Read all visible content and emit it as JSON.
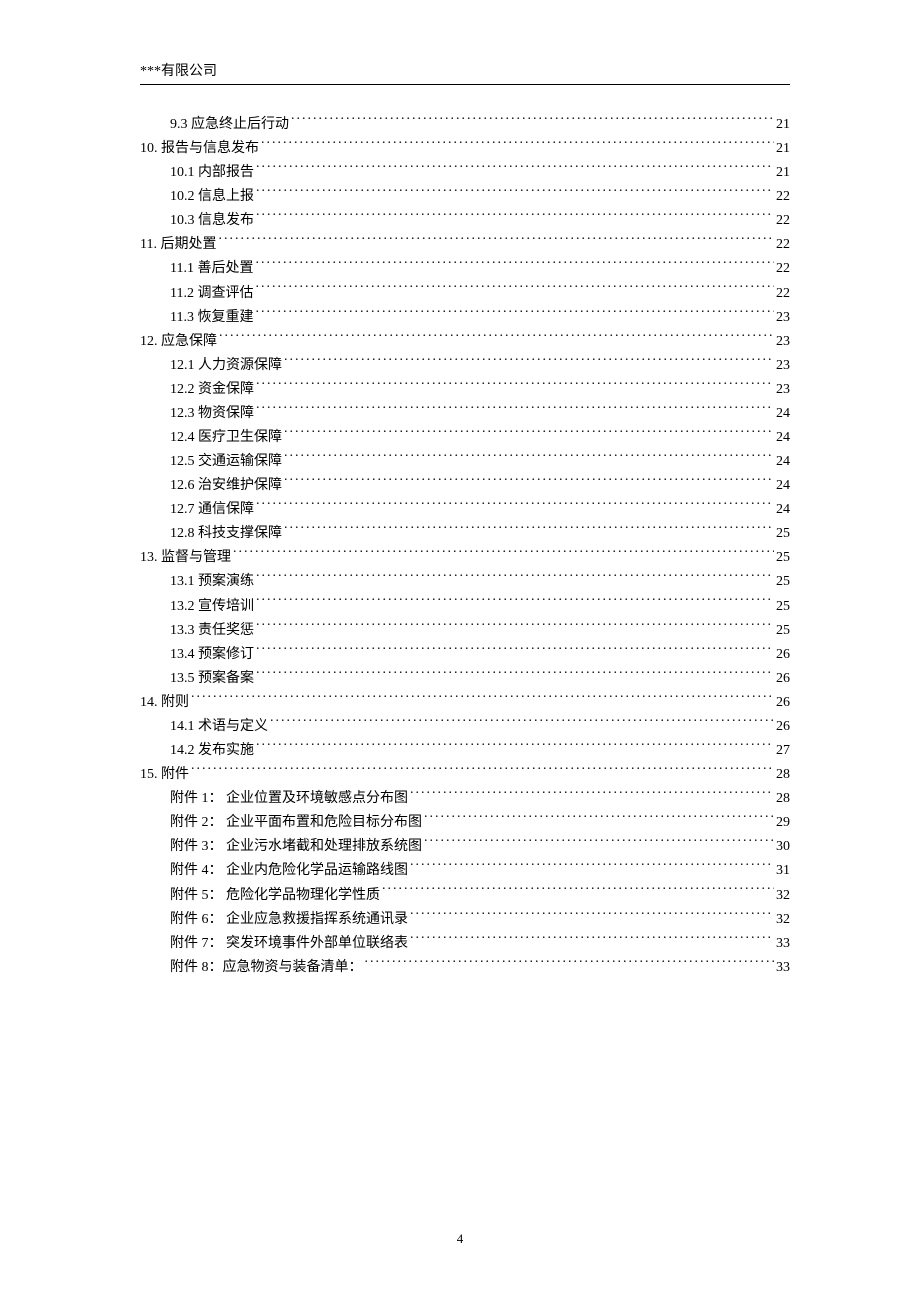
{
  "header": "***有限公司",
  "pageNumber": "4",
  "toc": [
    {
      "level": 2,
      "label": "9.3  应急终止后行动",
      "page": "21"
    },
    {
      "level": 1,
      "label": "10.  报告与信息发布",
      "page": "21"
    },
    {
      "level": 2,
      "label": "10.1  内部报告",
      "page": "21"
    },
    {
      "level": 2,
      "label": "10.2  信息上报",
      "page": "22"
    },
    {
      "level": 2,
      "label": "10.3  信息发布",
      "page": "22"
    },
    {
      "level": 1,
      "label": "11.  后期处置",
      "page": "22"
    },
    {
      "level": 2,
      "label": "11.1  善后处置",
      "page": "22"
    },
    {
      "level": 2,
      "label": "11.2  调查评估",
      "page": "22"
    },
    {
      "level": 2,
      "label": "11.3  恢复重建",
      "page": "23"
    },
    {
      "level": 1,
      "label": "12.  应急保障",
      "page": "23"
    },
    {
      "level": 2,
      "label": "12.1  人力资源保障",
      "page": "23"
    },
    {
      "level": 2,
      "label": "12.2  资金保障",
      "page": "23"
    },
    {
      "level": 2,
      "label": "12.3  物资保障",
      "page": "24"
    },
    {
      "level": 2,
      "label": "12.4  医疗卫生保障",
      "page": "24"
    },
    {
      "level": 2,
      "label": "12.5  交通运输保障",
      "page": "24"
    },
    {
      "level": 2,
      "label": "12.6  治安维护保障",
      "page": "24"
    },
    {
      "level": 2,
      "label": "12.7  通信保障",
      "page": "24"
    },
    {
      "level": 2,
      "label": "12.8  科技支撑保障",
      "page": "25"
    },
    {
      "level": 1,
      "label": "13.  监督与管理",
      "page": "25"
    },
    {
      "level": 2,
      "label": "13.1  预案演练",
      "page": "25"
    },
    {
      "level": 2,
      "label": "13.2  宣传培训",
      "page": "25"
    },
    {
      "level": 2,
      "label": "13.3  责任奖惩",
      "page": "25"
    },
    {
      "level": 2,
      "label": "13.4  预案修订",
      "page": "26"
    },
    {
      "level": 2,
      "label": "13.5  预案备案",
      "page": "26"
    },
    {
      "level": 1,
      "label": "14.  附则",
      "page": "26"
    },
    {
      "level": 2,
      "label": "14.1  术语与定义",
      "page": "26"
    },
    {
      "level": 2,
      "label": "14.2  发布实施",
      "page": "27"
    },
    {
      "level": 1,
      "label": "15.  附件",
      "page": "28"
    },
    {
      "level": 2,
      "label": "附件 1： 企业位置及环境敏感点分布图",
      "page": "28"
    },
    {
      "level": 2,
      "label": "附件 2： 企业平面布置和危险目标分布图",
      "page": "29"
    },
    {
      "level": 2,
      "label": "附件 3： 企业污水堵截和处理排放系统图",
      "page": "30"
    },
    {
      "level": 2,
      "label": "附件 4： 企业内危险化学品运输路线图",
      "page": "31"
    },
    {
      "level": 2,
      "label": "附件 5： 危险化学品物理化学性质",
      "page": "32"
    },
    {
      "level": 2,
      "label": "附件 6： 企业应急救援指挥系统通讯录",
      "page": "32"
    },
    {
      "level": 2,
      "label": "附件 7： 突发环境事件外部单位联络表",
      "page": "33"
    },
    {
      "level": 2,
      "label": "附件 8：应急物资与装备清单：",
      "page": "33"
    }
  ]
}
